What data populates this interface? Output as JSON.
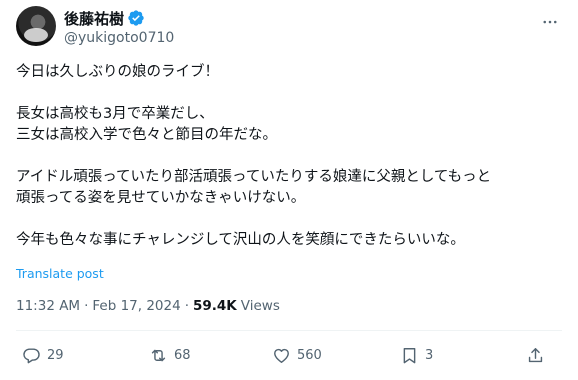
{
  "author": {
    "display_name": "後藤祐樹",
    "handle": "@yukigoto0710",
    "verified": true,
    "avatar_icon": "profile-photo"
  },
  "tweet": {
    "lines": [
      "今日は久しぶりの娘のライブ！",
      "",
      "長女は高校も3月で卒業だし、",
      "三女は高校入学で色々と節目の年だな。",
      "",
      "アイドル頑張っていたり部活頑張っていたりする娘達に父親としてもっと",
      "頑張ってる姿を見せていかなきゃいけない。",
      "",
      "今年も色々な事にチャレンジして沢山の人を笑顔にできたらいいな。"
    ],
    "translate_label": "Translate post",
    "time": "11:32 AM",
    "separator": "·",
    "date": "Feb 17, 2024",
    "views_count": "59.4K",
    "views_label": "Views"
  },
  "actions": {
    "reply_count": "29",
    "retweet_count": "68",
    "like_count": "560",
    "bookmark_count": "3"
  },
  "colors": {
    "accent": "#1d9bf0",
    "text": "#0f1419",
    "muted": "#536471"
  }
}
